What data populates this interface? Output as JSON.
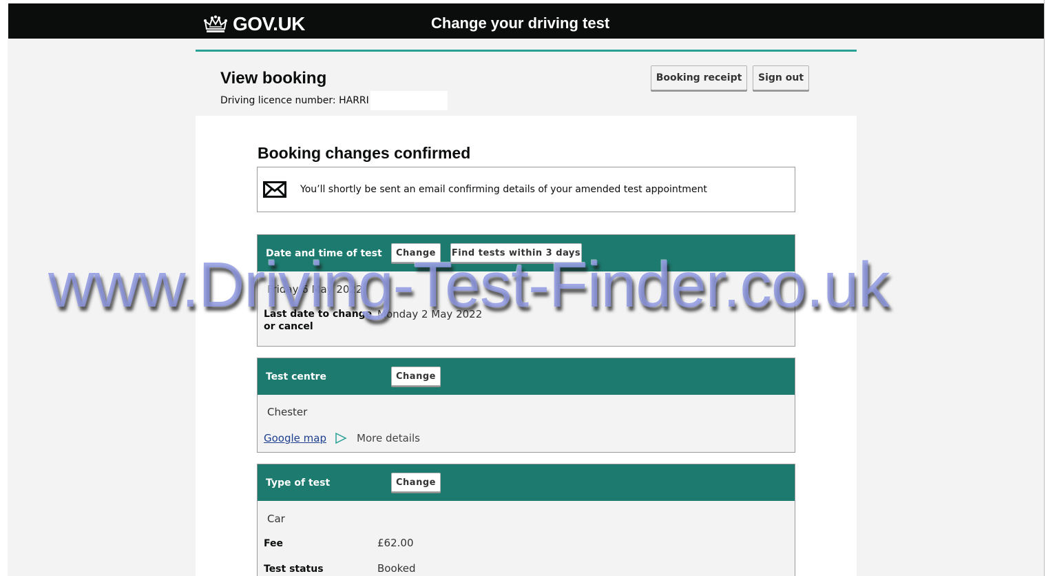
{
  "header": {
    "logo_text": "GOV.UK",
    "service_name": "Change your driving test"
  },
  "account": {
    "title": "View booking",
    "licence_label": "Driving licence number: HARRI",
    "booking_receipt_label": "Booking receipt",
    "sign_out_label": "Sign out"
  },
  "confirmation": {
    "title": "Booking changes confirmed",
    "notice": "You’ll shortly be sent an email confirming details of your amended test appointment"
  },
  "date_section": {
    "heading": "Date and time of test",
    "change_label": "Change",
    "find_label": "Find tests within 3 days",
    "date_value": "Friday 6 May 2022",
    "last_date_key": "Last date to change or cancel",
    "last_date_value": "Monday 2 May 2022"
  },
  "centre_section": {
    "heading": "Test centre",
    "change_label": "Change",
    "centre_value": "Chester",
    "map_link": "Google map",
    "more_details": "More details"
  },
  "type_section": {
    "heading": "Type of test",
    "change_label": "Change",
    "type_value": "Car",
    "fee_key": "Fee",
    "fee_value": "£62.00",
    "status_key": "Test status",
    "status_value": "Booked"
  },
  "watermark": "www.Driving-Test-Finder.co.uk",
  "colors": {
    "header": "#0b0c0c",
    "section_head": "#1d7a6e",
    "accent_rule": "#28a197",
    "link": "#1d3f8f"
  }
}
